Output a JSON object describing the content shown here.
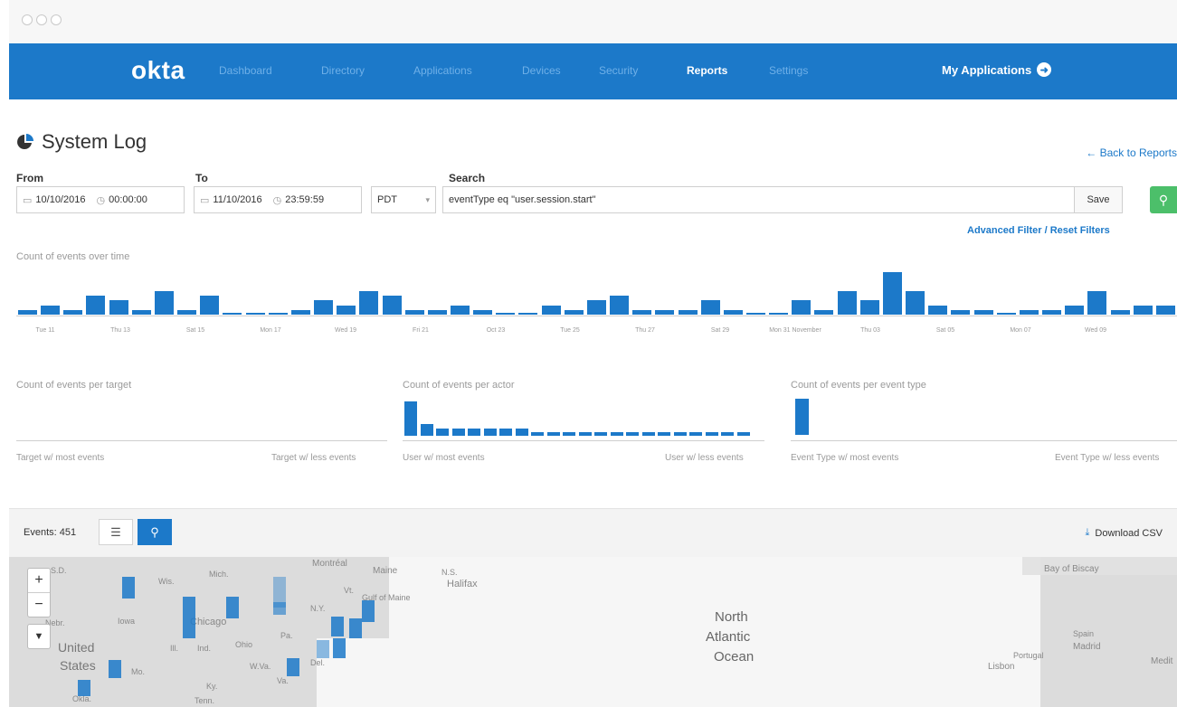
{
  "nav": {
    "logo": "okta",
    "items": [
      "Dashboard",
      "Directory",
      "Applications",
      "Devices",
      "Security",
      "Reports",
      "Settings"
    ],
    "active": "Reports",
    "my_apps": "My Applications"
  },
  "page": {
    "title": "System Log",
    "back_link": "← Back to Reports"
  },
  "filters": {
    "from_label": "From",
    "to_label": "To",
    "search_label": "Search",
    "from_date": "10/10/2016",
    "from_time": "00:00:00",
    "to_date": "11/10/2016",
    "to_time": "23:59:59",
    "timezone": "PDT",
    "search_value": "eventType eq \"user.session.start\"",
    "save": "Save",
    "advanced": "Advanced Filter / Reset Filters"
  },
  "timeline": {
    "label": "Count of events over time",
    "ticks": [
      "Tue 11",
      "Thu 13",
      "Sat 15",
      "Mon 17",
      "Wed 19",
      "Fri 21",
      "Oct 23",
      "Tue 25",
      "Thu 27",
      "Sat 29",
      "Mon 31 November",
      "Thu 03",
      "Sat 05",
      "Mon 07",
      "Wed 09"
    ]
  },
  "panels": {
    "target": {
      "label": "Count of events per target",
      "most": "Target w/ most events",
      "less": "Target w/ less events"
    },
    "actor": {
      "label": "Count of events per actor",
      "most": "User w/ most events",
      "less": "User w/ less events"
    },
    "event_type": {
      "label": "Count of events per event type",
      "most": "Event Type w/ most events",
      "less": "Event Type w/ less events"
    }
  },
  "events": {
    "count_label": "Events: 451",
    "download": "Download CSV"
  },
  "map": {
    "labels": {
      "montreal": "Montréal",
      "maine": "Maine",
      "ns": "N.S.",
      "halifax": "Halifax",
      "wis": "Wis.",
      "mich": "Mich.",
      "vt": "Vt.",
      "ny": "N.Y.",
      "gulf": "Gulf of Maine",
      "iowa": "Iowa",
      "chicago": "Chicago",
      "pa": "Pa.",
      "ill": "Ill.",
      "ind": "Ind.",
      "ohio": "Ohio",
      "us1": "United",
      "us2": "States",
      "mo": "Mo.",
      "wva": "W.Va.",
      "va": "Va.",
      "del": "Del.",
      "ky": "Ky.",
      "tenn": "Tenn.",
      "okla": "Okla.",
      "nebr": "Nebr.",
      "sd": "S.D.",
      "ocean1": "North",
      "ocean2": "Atlantic",
      "ocean3": "Ocean",
      "biscay": "Bay of Biscay",
      "spain": "Spain",
      "madrid": "Madrid",
      "portugal": "Portugal",
      "lisbon": "Lisbon",
      "medit": "Medit"
    }
  },
  "colors": {
    "brand": "#1c79c9",
    "bars": "#1c79c9",
    "go": "#4cbf6a"
  },
  "chart_data": [
    {
      "type": "bar",
      "title": "Count of events over time",
      "categories": [
        "Tue 11",
        "Thu 13",
        "Sat 15",
        "Mon 17",
        "Wed 19",
        "Fri 21",
        "Oct 23",
        "Tue 25",
        "Thu 27",
        "Sat 29",
        "Mon 31 November",
        "Thu 03",
        "Sat 05",
        "Mon 07",
        "Wed 09"
      ],
      "values": [
        1,
        2,
        1,
        4,
        3,
        1,
        5,
        1,
        4,
        0,
        0,
        0,
        1,
        3,
        2,
        5,
        4,
        1,
        1,
        2,
        1,
        0,
        0,
        2,
        1,
        3,
        4,
        1,
        1,
        1,
        3,
        1,
        0,
        0,
        3,
        1,
        5,
        3,
        9,
        5,
        2,
        1,
        1,
        0,
        1,
        1,
        2,
        5,
        1,
        2,
        2
      ],
      "ylim": [
        0,
        10
      ]
    },
    {
      "type": "bar",
      "title": "Count of events per actor",
      "values": [
        9,
        3,
        2,
        2,
        2,
        2,
        2,
        2,
        1,
        1,
        1,
        1,
        1,
        1,
        1,
        1,
        1,
        1,
        1,
        1,
        1,
        1
      ],
      "ylim": [
        0,
        10
      ]
    },
    {
      "type": "bar",
      "title": "Count of events per event type",
      "values": [
        1
      ],
      "ylim": [
        0,
        1
      ]
    }
  ]
}
